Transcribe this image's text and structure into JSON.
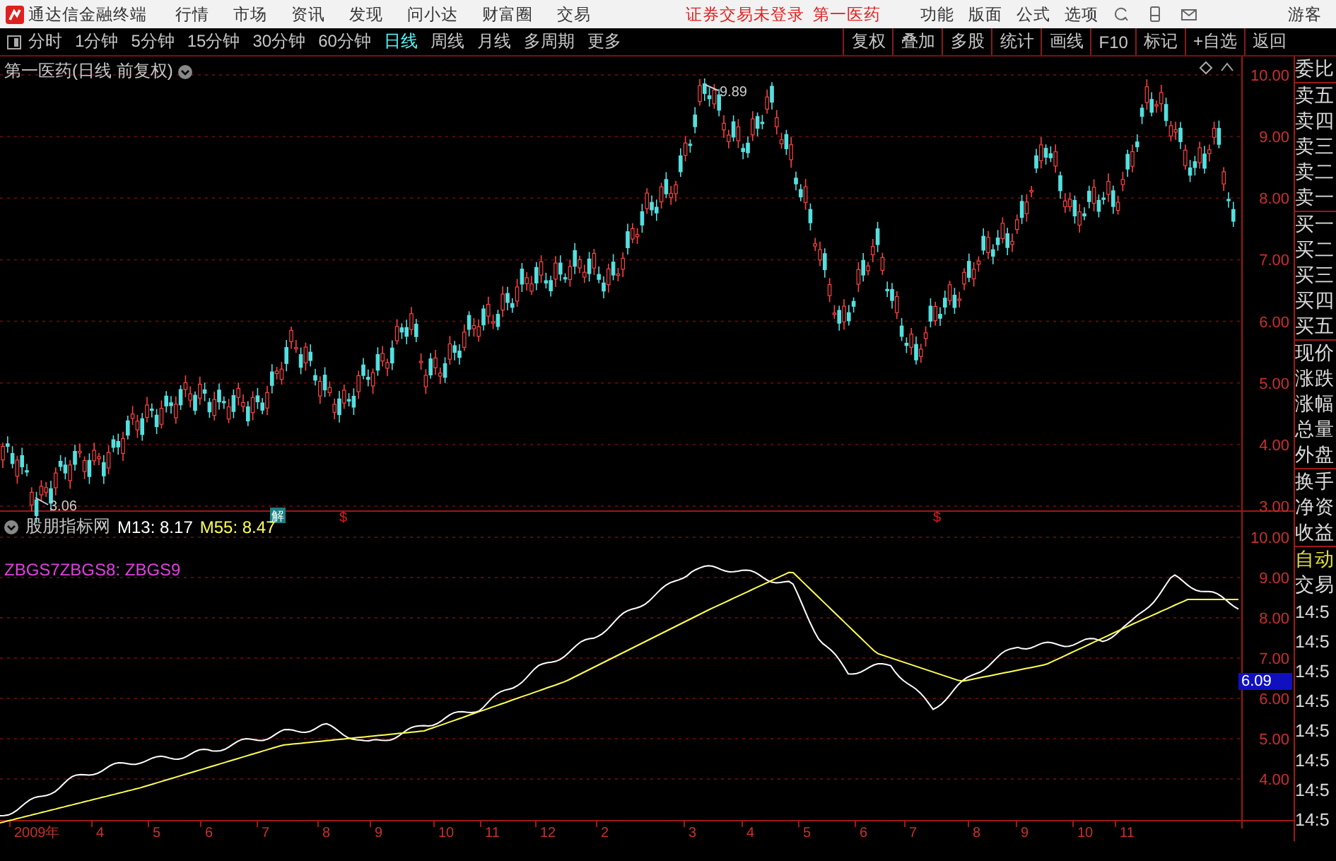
{
  "app": {
    "title": "通达信金融终端"
  },
  "menu": [
    "行情",
    "市场",
    "资讯",
    "发现",
    "问小达",
    "财富圈",
    "交易"
  ],
  "status": [
    "证券交易未登录",
    "第一医药"
  ],
  "right_menu": [
    "功能",
    "版面",
    "公式",
    "选项"
  ],
  "user": "游客",
  "periods": [
    {
      "label": "分时",
      "selected": false
    },
    {
      "label": "1分钟",
      "selected": false
    },
    {
      "label": "5分钟",
      "selected": false
    },
    {
      "label": "15分钟",
      "selected": false
    },
    {
      "label": "30分钟",
      "selected": false
    },
    {
      "label": "60分钟",
      "selected": false
    },
    {
      "label": "日线",
      "selected": true
    },
    {
      "label": "周线",
      "selected": false
    },
    {
      "label": "月线",
      "selected": false
    },
    {
      "label": "多周期",
      "selected": false
    },
    {
      "label": "更多",
      "selected": false
    }
  ],
  "tools": [
    "复权",
    "叠加",
    "多股",
    "统计",
    "画线",
    "F10",
    "标记",
    "+自选",
    "返回"
  ],
  "price_chart": {
    "title": "第一医药(日线 前复权)",
    "y_labels": [
      "10.00",
      "9.00",
      "8.00",
      "7.00",
      "6.00",
      "5.00",
      "4.00",
      "3.00"
    ],
    "high_label": "9.89",
    "low_label": "3.06",
    "markers": [
      {
        "kind": "unlock",
        "text": "解"
      },
      {
        "kind": "dollar",
        "text": "$"
      },
      {
        "kind": "dollar",
        "text": "$"
      }
    ]
  },
  "indicator": {
    "name": "股朋指标网",
    "values": [
      {
        "label": "M13: 8.17",
        "color": "#ffffff"
      },
      {
        "label": "M55: 8.47",
        "color": "#ffff54"
      }
    ],
    "formula": "ZBGS7ZBGS8: ZBGS9",
    "y_labels": [
      "10.00",
      "9.00",
      "8.00",
      "7.00",
      "6.00",
      "5.00",
      "4.00"
    ],
    "current": "6.09"
  },
  "x_axis": [
    "2009年",
    "4",
    "5",
    "6",
    "7",
    "8",
    "9",
    "10",
    "11",
    "12",
    "2",
    "3",
    "4",
    "5",
    "6",
    "7",
    "8",
    "9",
    "10",
    "11"
  ],
  "quote_panel": {
    "labels": [
      "委比",
      "卖五",
      "卖四",
      "卖三",
      "卖二",
      "卖一",
      "买一",
      "买二",
      "买三",
      "买四",
      "买五",
      "现价",
      "涨跌",
      "涨幅",
      "总量",
      "外盘",
      "换手",
      "净资",
      "收益"
    ],
    "auto": "自动",
    "trade": "交易",
    "times": [
      "14:5",
      "14:5",
      "14:5",
      "14:5",
      "14:5",
      "14:5",
      "14:5",
      "14:5"
    ]
  }
}
